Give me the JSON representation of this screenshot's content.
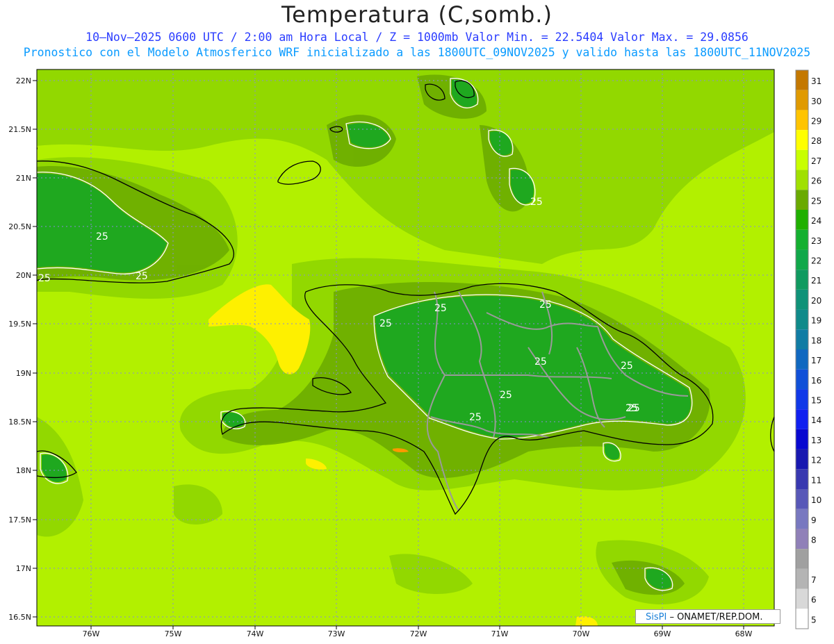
{
  "title": "Temperatura (C,somb.)",
  "subtitle_line1": "10–Nov–2025  0600 UTC / 2:00 am Hora Local / Z = 1000mb   Valor Min. = 22.5404  Valor Max. = 29.0856",
  "subtitle_line2": "Pronostico con el Modelo Atmosferico WRF inicializado a las 1800UTC_09NOV2025 y valido hasta las  1800UTC_11NOV2025",
  "colors": {
    "ocean_warm": "#b2f000",
    "ocean_mid": "#92d800",
    "land_cool": "#1fa81f",
    "land_mid": "#7ab800",
    "hot_spot": "#fef000",
    "coast": "#000000",
    "border": "#999999",
    "grid": "#8a8ad8",
    "contour": "#ffffff"
  },
  "axes": {
    "lat_labels": [
      "22N",
      "21.5N",
      "21N",
      "20.5N",
      "20N",
      "19.5N",
      "19N",
      "18.5N",
      "18N",
      "17.5N",
      "17N",
      "16.5N"
    ],
    "lon_labels": [
      "76W",
      "75W",
      "74W",
      "73W",
      "72W",
      "71W",
      "70W",
      "69W",
      "68W"
    ]
  },
  "contour_labels": [
    "25",
    "25",
    "25",
    "25",
    "25",
    "25",
    "25",
    "25",
    "25",
    "25",
    "25",
    "25",
    "25"
  ],
  "colorbar": {
    "levels": [
      {
        "label": "31",
        "color": "#c47800"
      },
      {
        "label": "30",
        "color": "#e09a00"
      },
      {
        "label": "29",
        "color": "#ffc400"
      },
      {
        "label": "28",
        "color": "#ffff00"
      },
      {
        "label": "27",
        "color": "#c8ff00"
      },
      {
        "label": "26",
        "color": "#a0e000"
      },
      {
        "label": "25",
        "color": "#6aaa00"
      },
      {
        "label": "24",
        "color": "#20b000"
      },
      {
        "label": "23",
        "color": "#14b030"
      },
      {
        "label": "22",
        "color": "#10a84a"
      },
      {
        "label": "21",
        "color": "#109a60"
      },
      {
        "label": "20",
        "color": "#0f9278"
      },
      {
        "label": "19",
        "color": "#0f8a8a"
      },
      {
        "label": "18",
        "color": "#107ca4"
      },
      {
        "label": "17",
        "color": "#1068c0"
      },
      {
        "label": "16",
        "color": "#1050d8"
      },
      {
        "label": "15",
        "color": "#1038e8"
      },
      {
        "label": "14",
        "color": "#1020f0"
      },
      {
        "label": "13",
        "color": "#0808d0"
      },
      {
        "label": "12",
        "color": "#1818b0"
      },
      {
        "label": "11",
        "color": "#3838b0"
      },
      {
        "label": "10",
        "color": "#5858b8"
      },
      {
        "label": "9",
        "color": "#7878c0"
      },
      {
        "label": "8",
        "color": "#9080b8"
      },
      {
        "label": "",
        "color": "#a0a0a0"
      },
      {
        "label": "7",
        "color": "#b4b4b4"
      },
      {
        "label": "6",
        "color": "#d8d8d8"
      },
      {
        "label": "5",
        "color": "#ffffff"
      }
    ]
  },
  "credit": {
    "brand": "SisPI",
    "text": " –  ONAMET/REP.DOM."
  }
}
